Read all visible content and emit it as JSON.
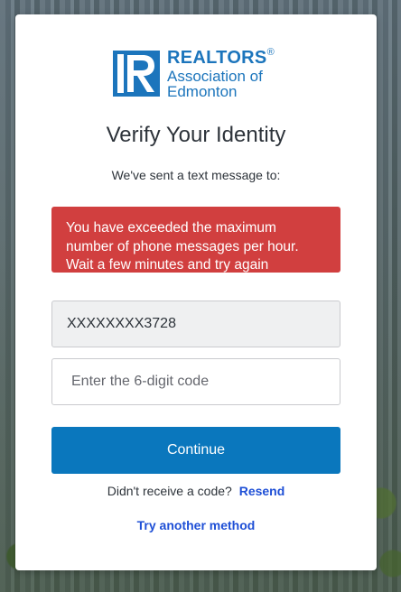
{
  "brand": {
    "line1": "REALTORS",
    "registered": "®",
    "line2": "Association of",
    "line3": "Edmonton",
    "color": "#1c75bc"
  },
  "page": {
    "title": "Verify Your Identity",
    "subtitle": "We've sent a text message to:"
  },
  "error": {
    "line1": "You have exceeded the maximum",
    "line2": "number of phone messages per hour.",
    "line3": "Wait a few minutes and try again",
    "color": "#d13f3f"
  },
  "form": {
    "phone_value": "XXXXXXXX3728",
    "code_placeholder": "Enter the 6-digit code",
    "code_value": "",
    "continue_label": "Continue"
  },
  "links": {
    "resend_prompt": "Didn't receive a code?",
    "resend_label": "Resend",
    "try_another_label": "Try another method",
    "color": "#1e4fd6"
  },
  "icons": {
    "logo": "realtor-r-logo-icon"
  }
}
